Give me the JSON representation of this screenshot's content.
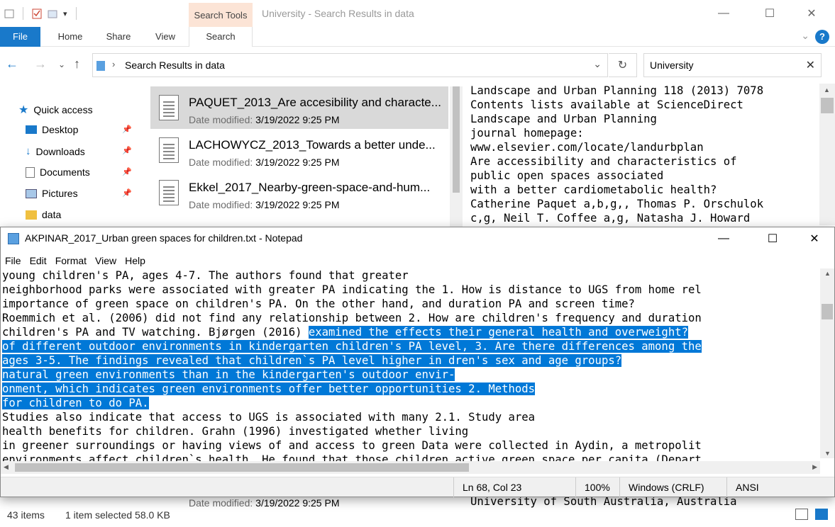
{
  "explorer": {
    "title": "University - Search Results in data",
    "context_tab": "Search Tools",
    "ribbon_tabs": [
      "File",
      "Home",
      "Share",
      "View",
      "Search"
    ],
    "address": "Search Results in data",
    "search_value": "University",
    "nav": {
      "quick_access": "Quick access",
      "items": [
        "Desktop",
        "Downloads",
        "Documents",
        "Pictures",
        "data"
      ]
    },
    "files": [
      {
        "name": "PAQUET_2013_Are accesibility and characte...",
        "date_label": "Date modified:",
        "date": "3/19/2022 9:25 PM"
      },
      {
        "name": "LACHOWYCZ_2013_Towards a better unde...",
        "date_label": "Date modified:",
        "date": "3/19/2022 9:25 PM"
      },
      {
        "name": "Ekkel_2017_Nearby-green-space-and-hum...",
        "date_label": "Date modified:",
        "date": "3/19/2022 9:25 PM"
      },
      {
        "name": "",
        "date_label": "Date modified:",
        "date": "3/19/2022 9:25 PM"
      }
    ],
    "preview_lines": [
      "Landscape and Urban Planning 118 (2013) 7078",
      "Contents lists available at ScienceDirect",
      "Landscape and Urban Planning",
      "journal homepage:",
      "www.elsevier.com/locate/landurbplan",
      "Are accessibility and characteristics of",
      "public open spaces associated",
      "with a better cardiometabolic health?",
      "Catherine Paquet a,b,g,, Thomas P. Orschulok",
      "c,g, Neil T. Coffee a,g, Natasha J. Howard"
    ],
    "preview_bottom_line": "University of South Australia, Australia",
    "status": {
      "count": "43 items",
      "selected": "1 item selected  58.0 KB"
    }
  },
  "notepad": {
    "title": "AKPINAR_2017_Urban green spaces for children.txt - Notepad",
    "menu": [
      "File",
      "Edit",
      "Format",
      "View",
      "Help"
    ],
    "lines": [
      {
        "pre": "young children's PA, ages 4-7. The authors found that greater",
        "sel": "",
        "post": ""
      },
      {
        "pre": "neighborhood parks were associated with greater PA indicating the 1. How is distance to UGS from home rel",
        "sel": "",
        "post": ""
      },
      {
        "pre": "importance of green space on children's PA. On the other hand, and duration PA and screen time?",
        "sel": "",
        "post": ""
      },
      {
        "pre": "Roemmich et al. (2006) did not find any relationship between 2. How are children's frequency and duration",
        "sel": "",
        "post": ""
      },
      {
        "pre": "children's PA and TV watching. Bjørgen (2016) ",
        "sel": "examined the effects their general health and overweight?",
        "post": ""
      },
      {
        "pre": "",
        "sel": "of different outdoor environments in kindergarten children's PA level, 3. Are there differences among the",
        "post": ""
      },
      {
        "pre": "",
        "sel": "ages 3-5. The findings revealed that children`s PA level higher in dren's sex and age groups?",
        "post": ""
      },
      {
        "pre": "",
        "sel": "natural green environments than in the kindergarten's outdoor envir-",
        "post": ""
      },
      {
        "pre": "",
        "sel": "onment, which indicates green environments offer better opportunities 2. Methods",
        "post": ""
      },
      {
        "pre": "",
        "sel": "for children to do PA.",
        "post": ""
      },
      {
        "pre": "Studies also indicate that access to UGS is associated with many 2.1. Study area",
        "sel": "",
        "post": ""
      },
      {
        "pre": "health benefits for children. Grahn (1996) investigated whether living",
        "sel": "",
        "post": ""
      },
      {
        "pre": "in greener surroundings or having views of and access to green Data were collected in Aydin, a metropolit",
        "sel": "",
        "post": ""
      },
      {
        "pre": "environments affect children`s health. He found that those children active green space per capita (Depart",
        "sel": "",
        "post": ""
      }
    ],
    "status": {
      "position": "Ln 68, Col 23",
      "zoom": "100%",
      "eol": "Windows (CRLF)",
      "encoding": "ANSI"
    }
  },
  "colors": {
    "accent": "#1979ca",
    "selection": "#0078d7",
    "context_tab": "#fce4d6"
  }
}
